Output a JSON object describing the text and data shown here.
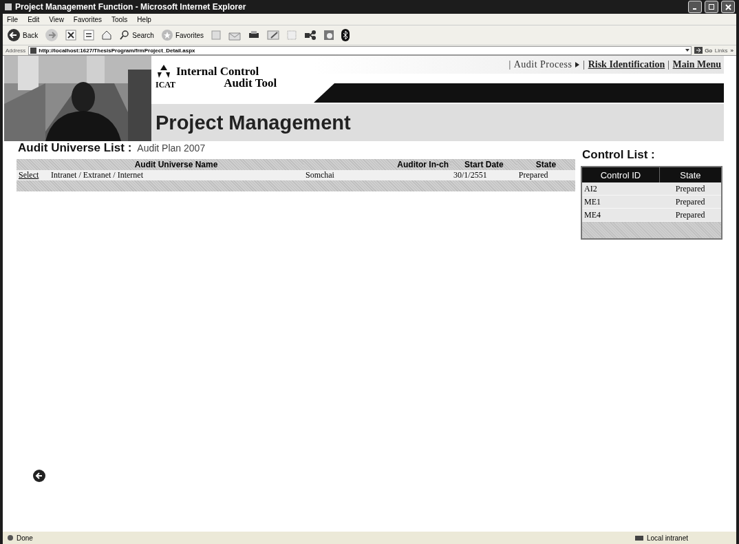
{
  "window": {
    "title": "Project Management Function - Microsoft Internet Explorer"
  },
  "menu": [
    "File",
    "Edit",
    "View",
    "Favorites",
    "Tools",
    "Help"
  ],
  "toolbar": {
    "back": "Back",
    "search": "Search",
    "favorites": "Favorites"
  },
  "address": {
    "label": "Address",
    "url": "http://localhost:1627/ThesisProgram/frmProject_Detail.aspx",
    "go": "Go",
    "links": "Links",
    "more": "»"
  },
  "header": {
    "logo_text": "ICAT",
    "title_line_1": "Internal Control",
    "title_line_2": "Audit Tool",
    "page_title": "Project Management",
    "nav": [
      {
        "kind": "separator",
        "text": "|"
      },
      {
        "kind": "text",
        "text": "Audit Process"
      },
      {
        "kind": "arrow"
      },
      {
        "kind": "separator",
        "text": "|"
      },
      {
        "kind": "link",
        "text": "Risk Identification"
      },
      {
        "kind": "separator",
        "text": "|"
      },
      {
        "kind": "link",
        "text": "Main Menu"
      }
    ]
  },
  "audit_list": {
    "title": "Audit Universe List :",
    "subtitle": "Audit Plan 2007",
    "columns": [
      "",
      "Audit Universe Name",
      "Auditor In-ch",
      "Start Date",
      "State"
    ],
    "rows": [
      {
        "action": "Select",
        "name": "Intranet / Extranet / Internet",
        "auditor": "Somchai",
        "start_date": "30/1/2551",
        "state": "Prepared"
      }
    ]
  },
  "control_list": {
    "title": "Control List :",
    "columns": [
      "Control ID",
      "State"
    ],
    "rows": [
      {
        "id": "AI2",
        "state": "Prepared"
      },
      {
        "id": "ME1",
        "state": "Prepared"
      },
      {
        "id": "ME4",
        "state": "Prepared"
      }
    ]
  },
  "status_bar": {
    "status": "Done",
    "zone": "Local intranet"
  }
}
